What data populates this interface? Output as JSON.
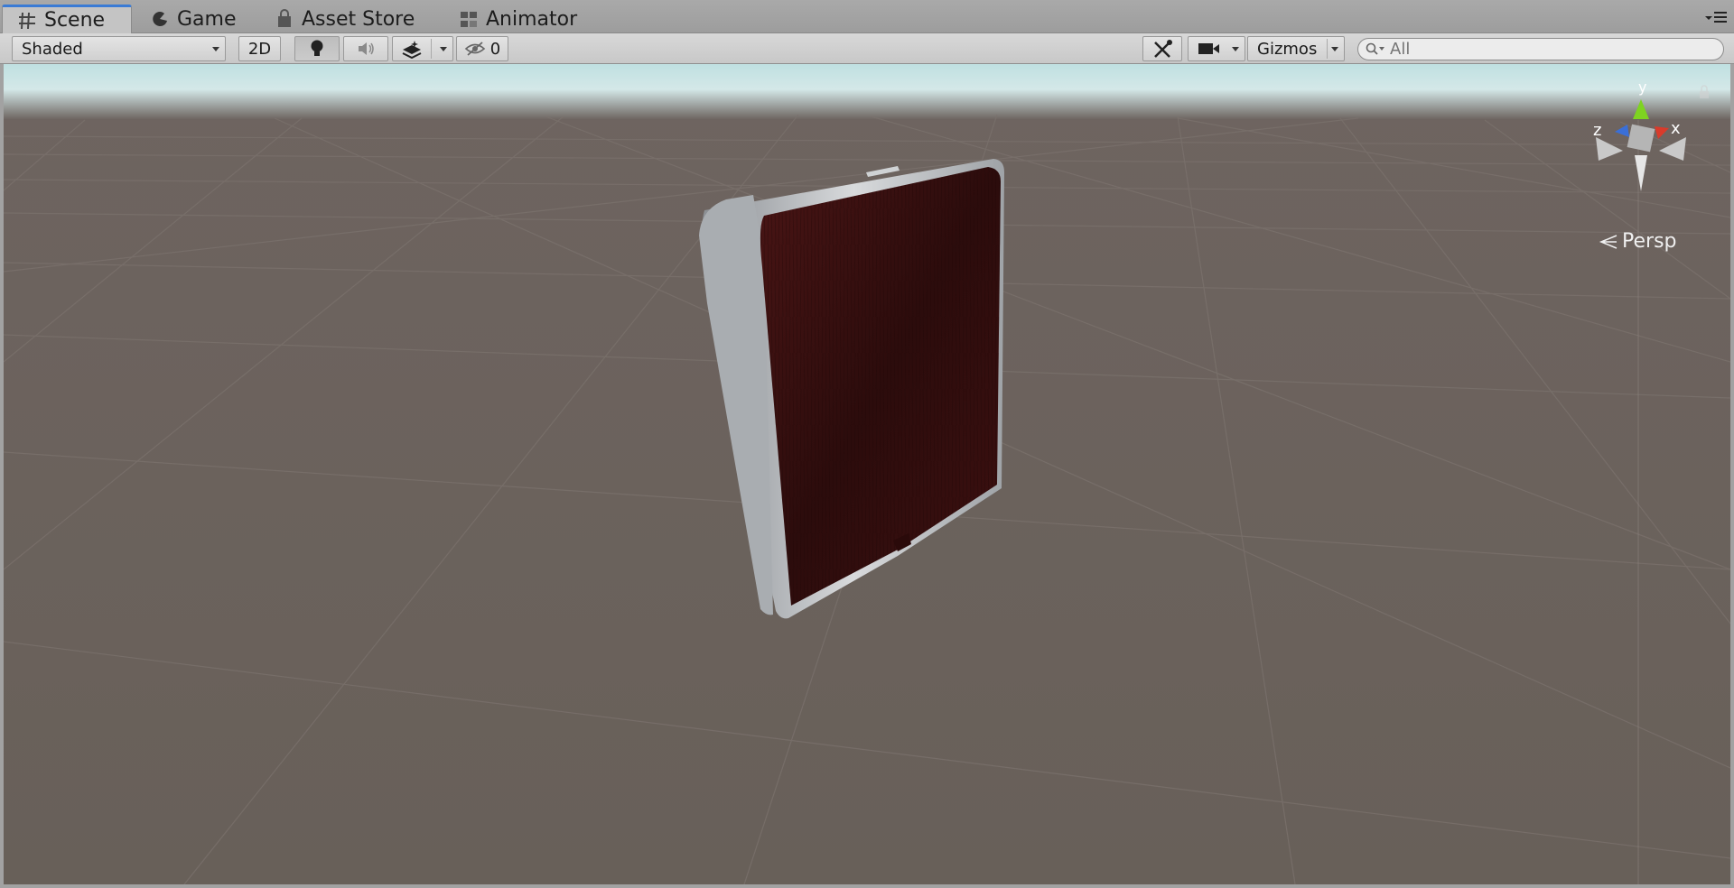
{
  "tabs": [
    {
      "label": "Scene",
      "icon": "scene-grid-icon",
      "active": true
    },
    {
      "label": "Game",
      "icon": "game-pacman-icon",
      "active": false
    },
    {
      "label": "Asset Store",
      "icon": "asset-store-bag-icon",
      "active": false
    },
    {
      "label": "Animator",
      "icon": "animator-nodes-icon",
      "active": false
    }
  ],
  "toolbar": {
    "draw_mode": "Shaded",
    "mode_2d": "2D",
    "hidden_count": "0",
    "gizmos": "Gizmos"
  },
  "search": {
    "placeholder": "All"
  },
  "viewport": {
    "projection": "Persp",
    "axes": {
      "x": "x",
      "y": "y",
      "z": "z"
    }
  },
  "colors": {
    "sky_top": "#b8dadc",
    "ground": "#6a5f5a",
    "axis_x": "#d93b2b",
    "axis_y": "#7ed321",
    "axis_z": "#3a6fd8",
    "table_top": "#3a1010"
  }
}
